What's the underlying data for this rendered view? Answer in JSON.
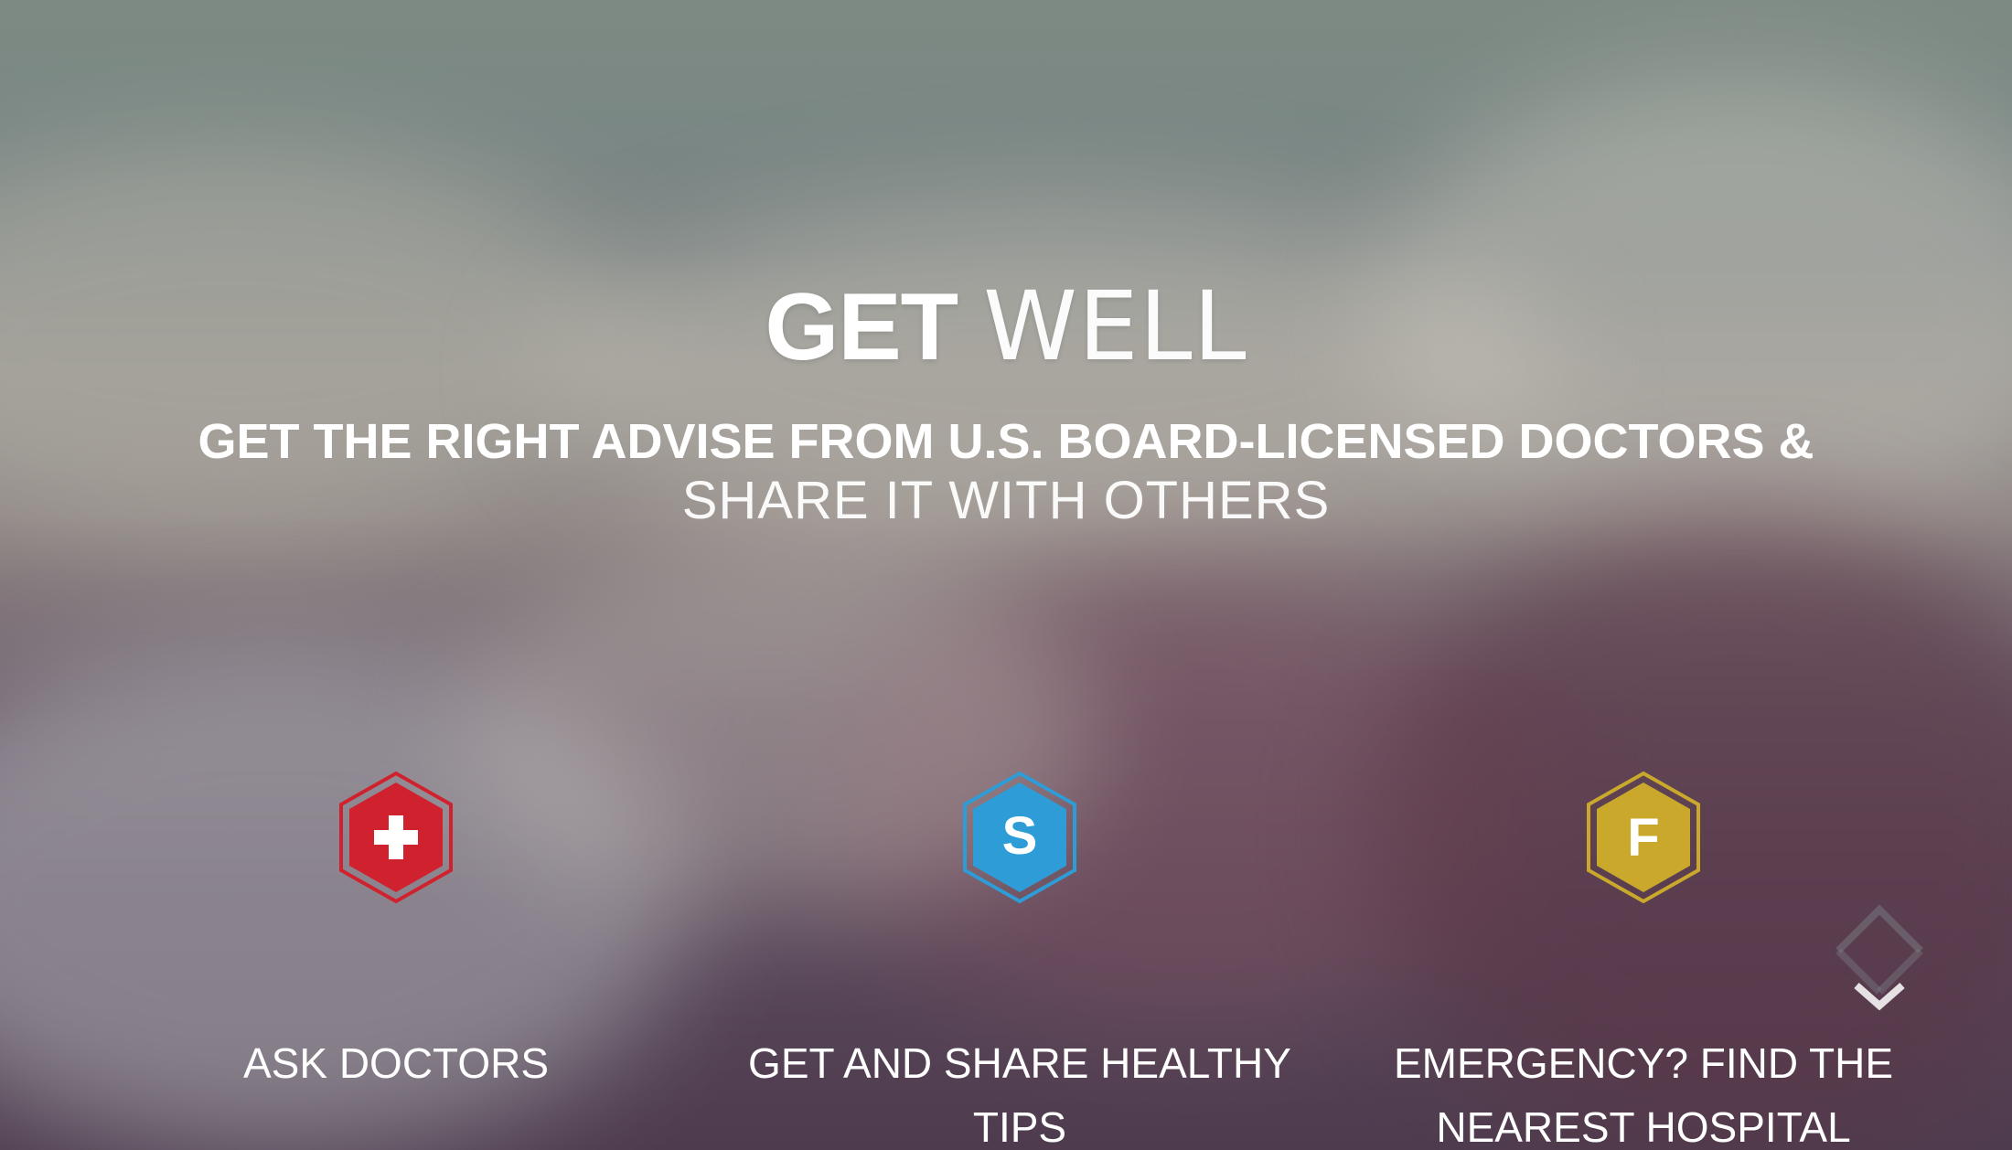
{
  "hero": {
    "title_strong": "GET",
    "title_light": "WELL",
    "subtitle_line1": "GET THE RIGHT ADVISE FROM U.S. BOARD-LICENSED DOCTORS &",
    "subtitle_line2": "SHARE IT WITH OTHERS"
  },
  "features": [
    {
      "icon": "medical-cross-icon",
      "glyph": "+",
      "color": "#d0222e",
      "label": "ASK DOCTORS"
    },
    {
      "icon": "share-s-icon",
      "glyph": "S",
      "color": "#2e9cd6",
      "label": "GET AND SHARE HEALTHY TIPS"
    },
    {
      "icon": "hospital-f-icon",
      "glyph": "F",
      "color": "#c9a82c",
      "label": "EMERGENCY? FIND THE NEAREST HOSPITAL"
    }
  ],
  "scroll_hint": {
    "icon": "scroll-down-chevron-icon"
  }
}
